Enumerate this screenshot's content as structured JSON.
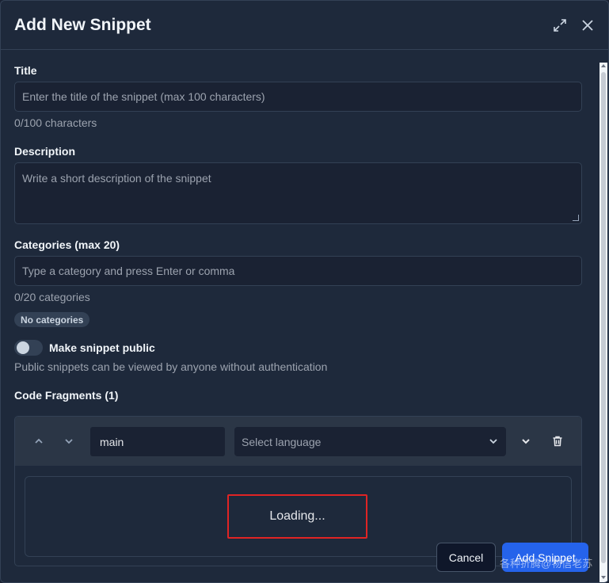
{
  "modal": {
    "title": "Add New Snippet"
  },
  "form": {
    "title_label": "Title",
    "title_placeholder": "Enter the title of the snippet (max 100 characters)",
    "title_counter": "0/100 characters",
    "description_label": "Description",
    "description_placeholder": "Write a short description of the snippet",
    "categories_label": "Categories (max 20)",
    "categories_placeholder": "Type a category and press Enter or comma",
    "categories_counter": "0/20 categories",
    "categories_empty_chip": "No categories",
    "public_toggle_label": "Make snippet public",
    "public_toggle_on": false,
    "public_hint": "Public snippets can be viewed by anyone without authentication",
    "fragments_label": "Code Fragments (1)"
  },
  "fragments": [
    {
      "name": "main",
      "language_placeholder": "Select language",
      "editor_status": "Loading..."
    }
  ],
  "actions": {
    "cancel_label": "Cancel",
    "submit_label": "Add Snippet"
  },
  "watermark": "各种折腾@物信老苏",
  "colors": {
    "background": "#1e293b",
    "accent": "#2563eb",
    "highlight_box": "#e02424"
  }
}
